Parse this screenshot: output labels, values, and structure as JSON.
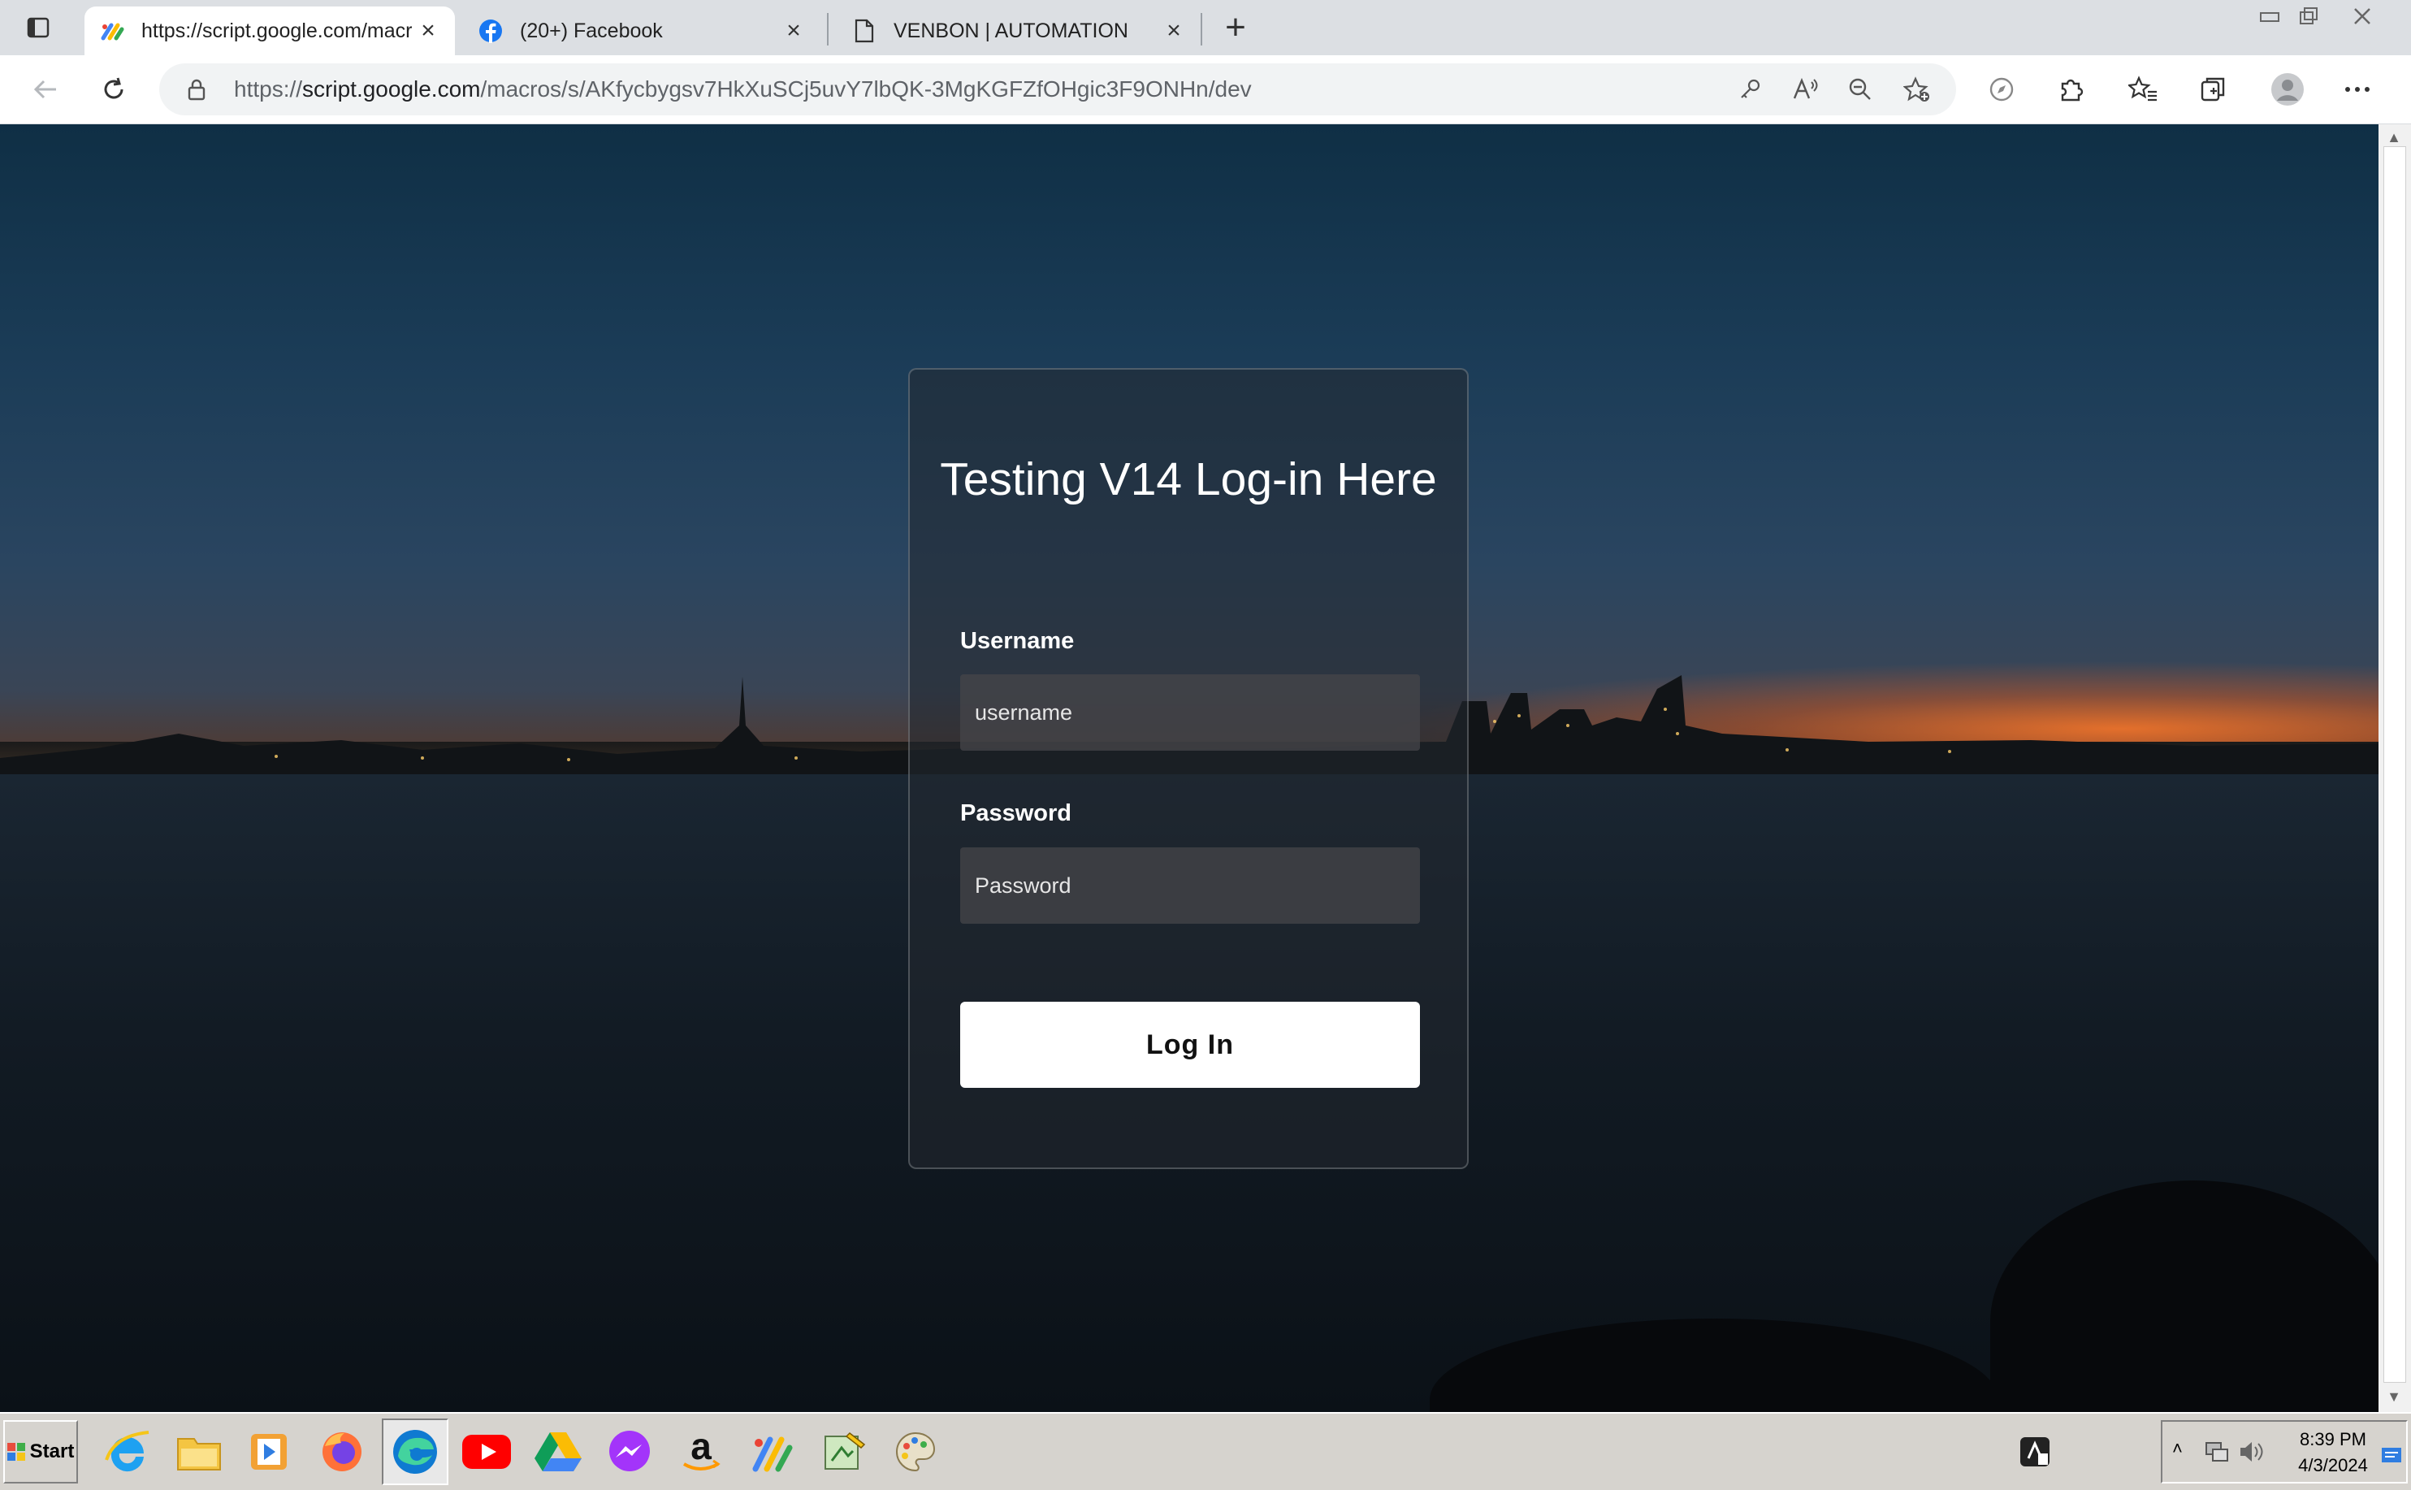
{
  "browser": {
    "tabs": [
      {
        "title": "https://script.google.com/macr",
        "active": true,
        "icon": "apps-script-icon"
      },
      {
        "title": "(20+) Facebook",
        "active": false,
        "icon": "facebook-icon"
      },
      {
        "title": "VENBON | AUTOMATION",
        "active": false,
        "icon": "page-icon"
      }
    ],
    "address": {
      "prefix": "https://",
      "domain": "script.google.com",
      "path": "/macros/s/AKfycbygsv7HkXuSCj5uvY7lbQK-3MgKGFZfOHgic3F9ONHn/dev"
    }
  },
  "login": {
    "title": "Testing V14 Log-in Here",
    "username_label": "Username",
    "username_placeholder": "username",
    "password_label": "Password",
    "password_placeholder": "Password",
    "login_button": "Log In"
  },
  "taskbar": {
    "start_label": "Start",
    "clock_time": "8:39 PM",
    "clock_date": "4/3/2024"
  },
  "colors": {
    "card_bg": "#232830",
    "button_bg": "#ffffff",
    "facebook_blue": "#1877f2"
  }
}
